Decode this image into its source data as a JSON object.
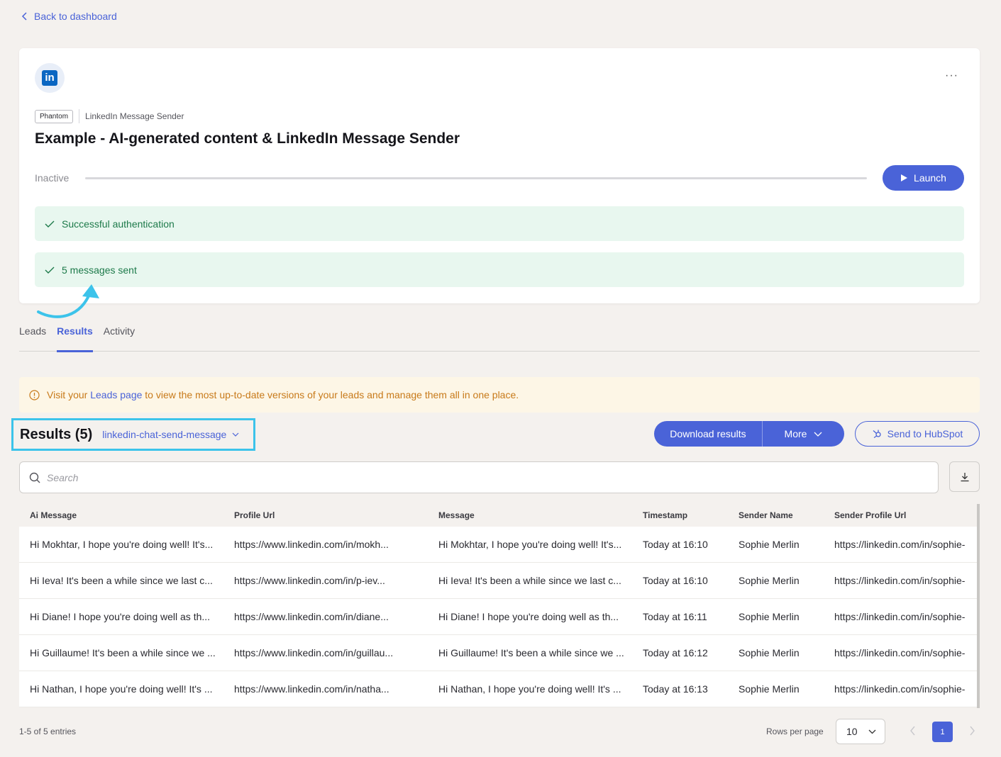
{
  "nav": {
    "back_label": "Back to dashboard"
  },
  "card": {
    "logo_text": "in",
    "tag": "Phantom",
    "subtitle": "LinkedIn Message Sender",
    "title": "Example - AI-generated content & LinkedIn Message Sender",
    "status": "Inactive",
    "progress": 0,
    "launch_label": "Launch",
    "notices": [
      "Successful authentication",
      "5 messages sent"
    ]
  },
  "tabs": [
    "Leads",
    "Results",
    "Activity"
  ],
  "active_tab": "Results",
  "banner": {
    "prefix": "Visit your ",
    "link": "Leads page",
    "suffix": " to view the most up-to-date versions of your leads and manage them all in one place."
  },
  "results": {
    "title": "Results (5)",
    "selector": "linkedin-chat-send-message",
    "download_label": "Download results",
    "more_label": "More",
    "hubspot_label": "Send to HubSpot"
  },
  "search": {
    "placeholder": "Search"
  },
  "table": {
    "columns": [
      "Ai Message",
      "Profile Url",
      "Message",
      "Timestamp",
      "Sender Name",
      "Sender Profile Url"
    ],
    "rows": [
      [
        "Hi Mokhtar, I hope you're doing well! It's...",
        "https://www.linkedin.com/in/mokh...",
        "Hi Mokhtar, I hope you're doing well! It's...",
        "Today at 16:10",
        "Sophie Merlin",
        "https://linkedin.com/in/sophie-"
      ],
      [
        "Hi Ieva! It's been a while since we last c...",
        "https://www.linkedin.com/in/p-iev...",
        "Hi Ieva! It's been a while since we last c...",
        "Today at 16:10",
        "Sophie Merlin",
        "https://linkedin.com/in/sophie-"
      ],
      [
        "Hi Diane! I hope you're doing well as th...",
        "https://www.linkedin.com/in/diane...",
        "Hi Diane! I hope you're doing well as th...",
        "Today at 16:11",
        "Sophie Merlin",
        "https://linkedin.com/in/sophie-"
      ],
      [
        "Hi Guillaume! It's been a while since we ...",
        "https://www.linkedin.com/in/guillau...",
        "Hi Guillaume! It's been a while since we ...",
        "Today at 16:12",
        "Sophie Merlin",
        "https://linkedin.com/in/sophie-"
      ],
      [
        "Hi Nathan, I hope you're doing well! It's ...",
        "https://www.linkedin.com/in/natha...",
        "Hi Nathan, I hope you're doing well! It's ...",
        "Today at 16:13",
        "Sophie Merlin",
        "https://linkedin.com/in/sophie-"
      ]
    ]
  },
  "footer": {
    "entries": "1-5 of 5 entries",
    "rows_label": "Rows per page",
    "rows_value": "10",
    "current_page": "1"
  },
  "colors": {
    "accent": "#4a63d8",
    "success_bg": "#e8f7ef",
    "success_text": "#1d7a4a",
    "warning_bg": "#fdf6e6",
    "highlight": "#3cc3ea"
  }
}
